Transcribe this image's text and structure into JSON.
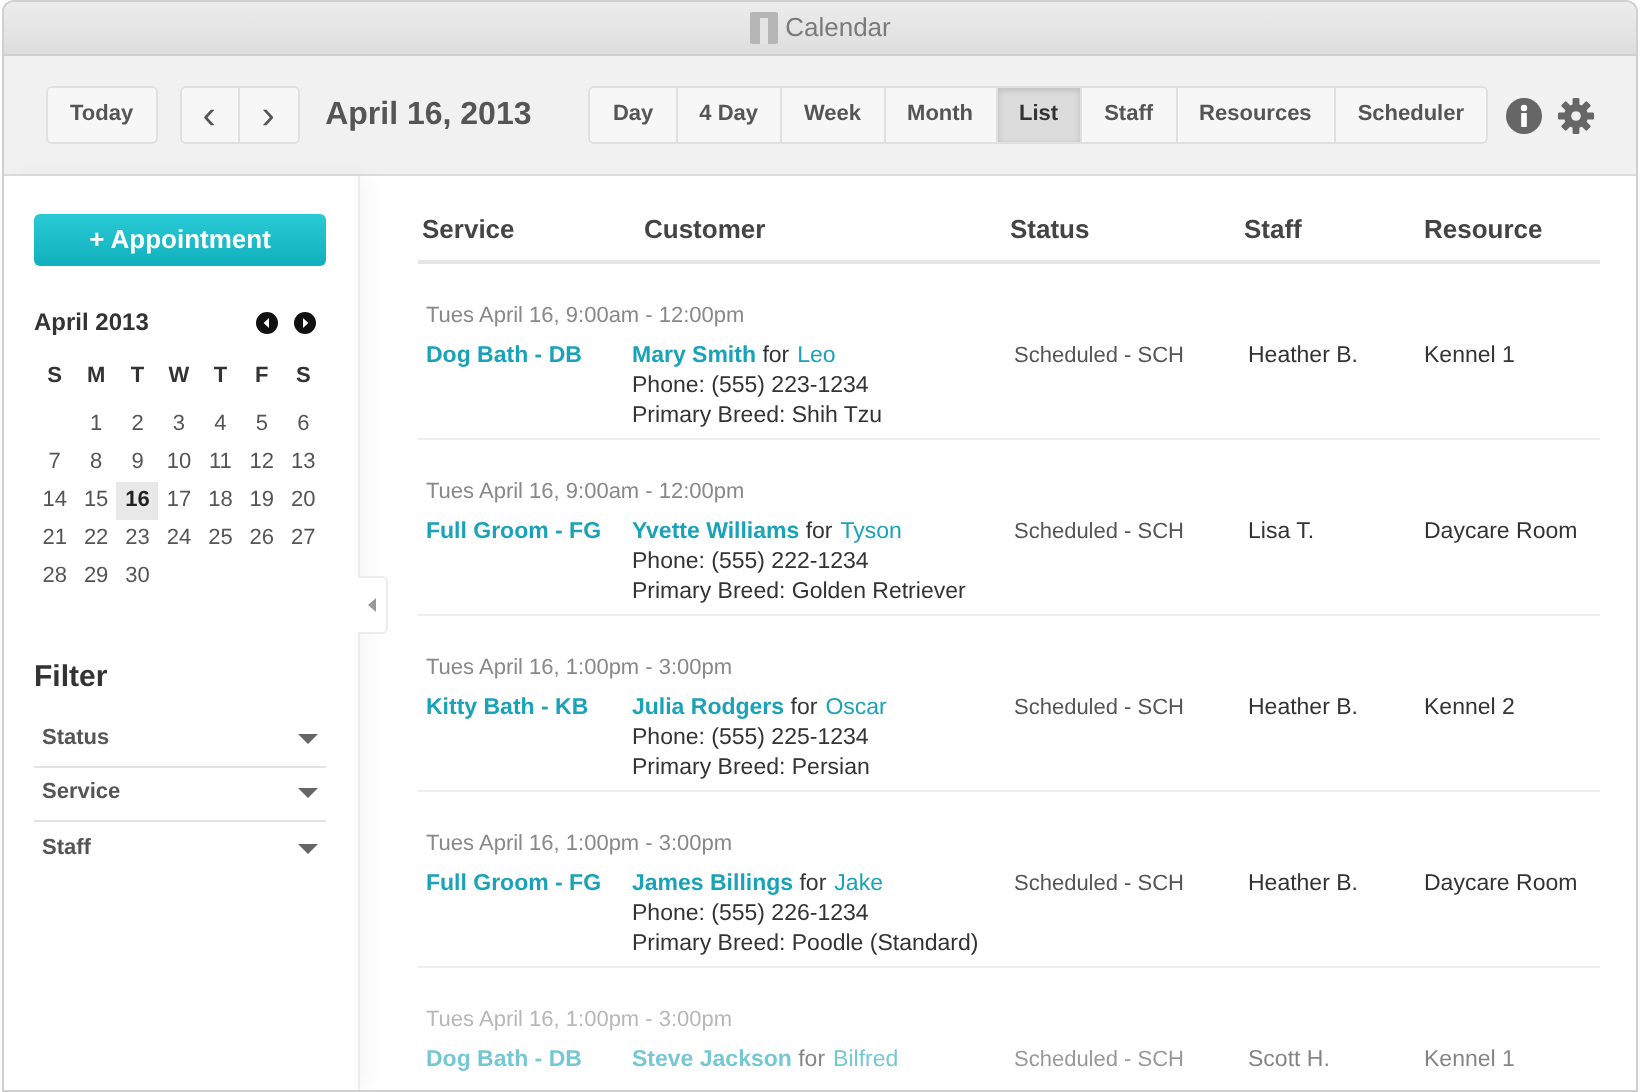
{
  "window": {
    "title": "Calendar"
  },
  "toolbar": {
    "today": "Today",
    "prev": "‹",
    "next": "›",
    "date": "April 16, 2013"
  },
  "views": [
    {
      "label": "Day",
      "selected": false
    },
    {
      "label": "4 Day",
      "selected": false
    },
    {
      "label": "Week",
      "selected": false
    },
    {
      "label": "Month",
      "selected": false
    },
    {
      "label": "List",
      "selected": true
    },
    {
      "label": "Staff",
      "selected": false
    },
    {
      "label": "Resources",
      "selected": false
    },
    {
      "label": "Scheduler",
      "selected": false
    }
  ],
  "sidebar": {
    "new_button": "+ Appointment",
    "calendar": {
      "month": "April 2013",
      "weekdays": [
        "S",
        "M",
        "T",
        "W",
        "T",
        "F",
        "S"
      ],
      "weeks": [
        [
          {
            "label": "1",
            "selected": false
          },
          {
            "label": "2",
            "selected": false
          },
          {
            "label": "3",
            "selected": false
          },
          {
            "label": "4",
            "selected": false
          },
          {
            "label": "5",
            "selected": false
          },
          {
            "label": "6",
            "selected": false
          }
        ],
        [
          {
            "label": "7",
            "selected": false
          },
          {
            "label": "8",
            "selected": false
          },
          {
            "label": "9",
            "selected": false
          },
          {
            "label": "10",
            "selected": false
          },
          {
            "label": "11",
            "selected": false
          },
          {
            "label": "12",
            "selected": false
          },
          {
            "label": "13",
            "selected": false
          }
        ],
        [
          {
            "label": "14",
            "selected": false
          },
          {
            "label": "15",
            "selected": false
          },
          {
            "label": "16",
            "selected": true
          },
          {
            "label": "17",
            "selected": false
          },
          {
            "label": "18",
            "selected": false
          },
          {
            "label": "19",
            "selected": false
          },
          {
            "label": "20",
            "selected": false
          }
        ],
        [
          {
            "label": "21",
            "selected": false
          },
          {
            "label": "22",
            "selected": false
          },
          {
            "label": "23",
            "selected": false
          },
          {
            "label": "24",
            "selected": false
          },
          {
            "label": "25",
            "selected": false
          },
          {
            "label": "26",
            "selected": false
          },
          {
            "label": "27",
            "selected": false
          }
        ],
        [
          {
            "label": "28",
            "selected": false
          },
          {
            "label": "29",
            "selected": false
          },
          {
            "label": "30",
            "selected": false
          }
        ]
      ]
    },
    "filter_title": "Filter",
    "filters": [
      "Status",
      "Service",
      "Staff"
    ]
  },
  "table": {
    "columns": [
      "Service",
      "Customer",
      "Status",
      "Staff",
      "Resource"
    ],
    "rows": [
      {
        "time": "Tues April 16, 9:00am - 12:00pm",
        "service": "Dog Bath - DB",
        "customer": "**Mary Smith** for",
        "pet": "Leo",
        "phone": "Phone: (555) 223-1234",
        "breed": "Primary Breed: Shih Tzu",
        "status": "Scheduled - SCH",
        "staff": "Heather B.",
        "resource": "Kennel 1",
        "faded": false
      },
      {
        "time": "Tues April 16, 9:00am - 12:00pm",
        "service": "Full Groom - FG",
        "customer": "**Yvette Williams** for",
        "pet": "Tyson",
        "phone": "Phone: (555) 222-1234",
        "breed": "Primary Breed: Golden Retriever",
        "status": "Scheduled - SCH",
        "staff": "Lisa T.",
        "resource": "Daycare Room",
        "faded": false
      },
      {
        "time": "Tues April 16, 1:00pm - 3:00pm",
        "service": "Kitty Bath - KB",
        "customer": "**Julia Rodgers** for",
        "pet": "Oscar",
        "phone": "Phone: (555) 225-1234",
        "breed": "Primary Breed: Persian",
        "status": "Scheduled - SCH",
        "staff": "Heather B.",
        "resource": "Kennel 2",
        "faded": false
      },
      {
        "time": "Tues April 16, 1:00pm - 3:00pm",
        "service": "Full Groom - FG",
        "customer": "**James Billings** for",
        "pet": "Jake",
        "phone": "Phone: (555) 226-1234",
        "breed": "Primary Breed: Poodle (Standard)",
        "status": "Scheduled - SCH",
        "staff": "Heather B.",
        "resource": "Daycare Room",
        "faded": false
      },
      {
        "time": "Tues April 16, 1:00pm - 3:00pm",
        "service": "Dog Bath - DB",
        "customer": "**Steve Jackson** for",
        "pet": "Bilfred",
        "status": "Scheduled - SCH",
        "staff": "Scott H.",
        "resource": "Kennel 1",
        "faded": true
      }
    ]
  }
}
